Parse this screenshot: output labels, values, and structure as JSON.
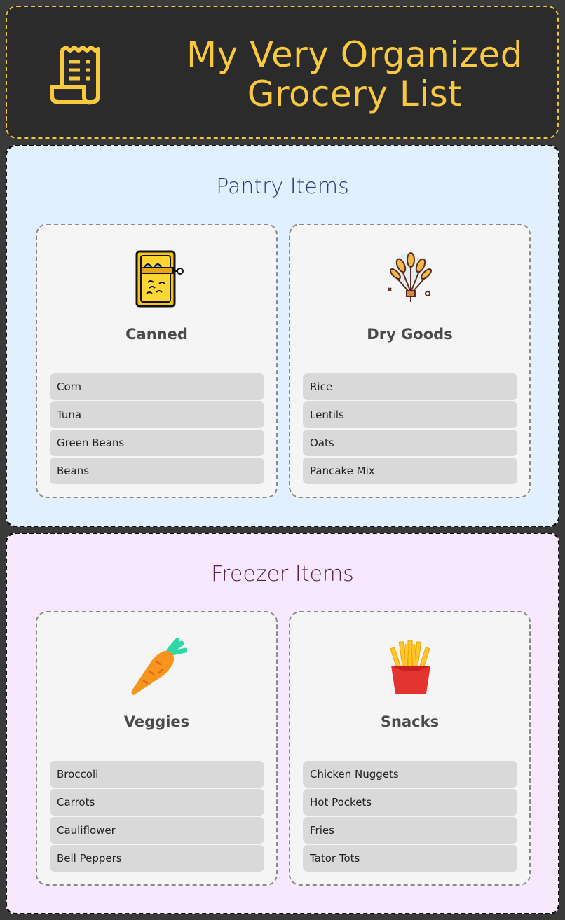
{
  "header": {
    "title_line1": "My Very Organized",
    "title_line2": "Grocery List",
    "icon": "receipt-icon"
  },
  "sections": [
    {
      "title": "Pantry Items",
      "cards": [
        {
          "title": "Canned",
          "icon": "canned-fish-icon",
          "items": [
            "Corn",
            "Tuna",
            "Green Beans",
            "Beans"
          ]
        },
        {
          "title": "Dry Goods",
          "icon": "wheat-icon",
          "items": [
            "Rice",
            "Lentils",
            "Oats",
            "Pancake Mix"
          ]
        }
      ]
    },
    {
      "title": "Freezer Items",
      "cards": [
        {
          "title": "Veggies",
          "icon": "carrot-icon",
          "items": [
            "Broccoli",
            "Carrots",
            "Cauliflower",
            "Bell Peppers"
          ]
        },
        {
          "title": "Snacks",
          "icon": "fries-icon",
          "items": [
            "Chicken Nuggets",
            "Hot Pockets",
            "Fries",
            "Tator Tots"
          ]
        }
      ]
    }
  ],
  "colors": {
    "accent": "#f8c93f",
    "header_bg": "#2b2b2b",
    "pantry_bg": "#e1effe",
    "freezer_bg": "#f8e8fd"
  }
}
